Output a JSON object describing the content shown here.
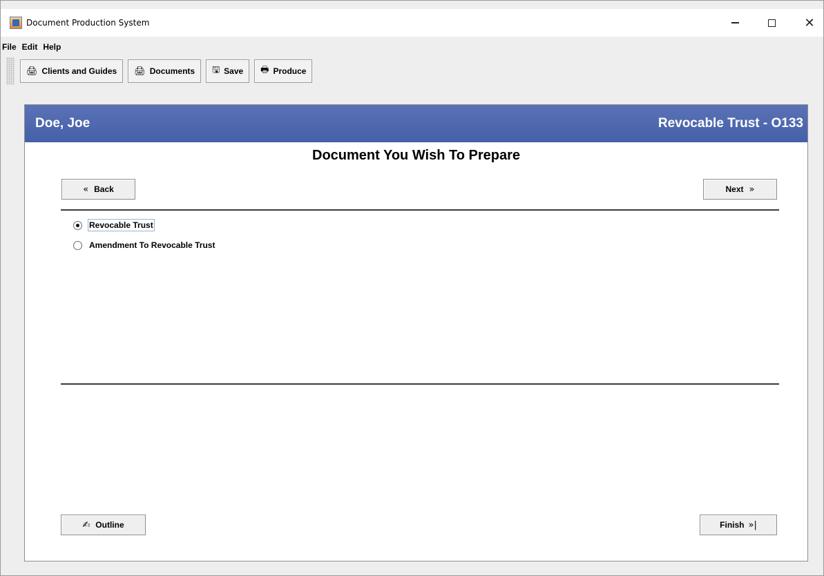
{
  "window": {
    "title": "Document Production System",
    "controls": {
      "minimize": "–",
      "maximize": "□",
      "close": "✕"
    }
  },
  "menu": {
    "items": [
      "File",
      "Edit",
      "Help"
    ]
  },
  "toolbar": {
    "buttons": [
      {
        "label": "Clients and Guides",
        "icon": "printer-icon",
        "glyph": "🖨"
      },
      {
        "label": "Documents",
        "icon": "printer-icon",
        "glyph": "🖨"
      },
      {
        "label": "Save",
        "icon": "floppy-disk-icon",
        "glyph": "🖫"
      },
      {
        "label": "Produce",
        "icon": "printer-icon",
        "glyph": "🖶"
      }
    ]
  },
  "banner": {
    "client_name": "Doe, Joe",
    "document_title": "Revocable Trust - O133",
    "color": "#4d66ae"
  },
  "page": {
    "heading": "Document You Wish To Prepare"
  },
  "nav": {
    "back_label": "Back",
    "back_glyph": "«",
    "next_label": "Next",
    "next_glyph": "»",
    "outline_label": "Outline",
    "outline_glyph": "✍",
    "finish_label": "Finish",
    "finish_glyph": "»|"
  },
  "options": [
    {
      "label": "Revocable Trust",
      "selected": true
    },
    {
      "label": "Amendment To Revocable Trust",
      "selected": false
    }
  ]
}
